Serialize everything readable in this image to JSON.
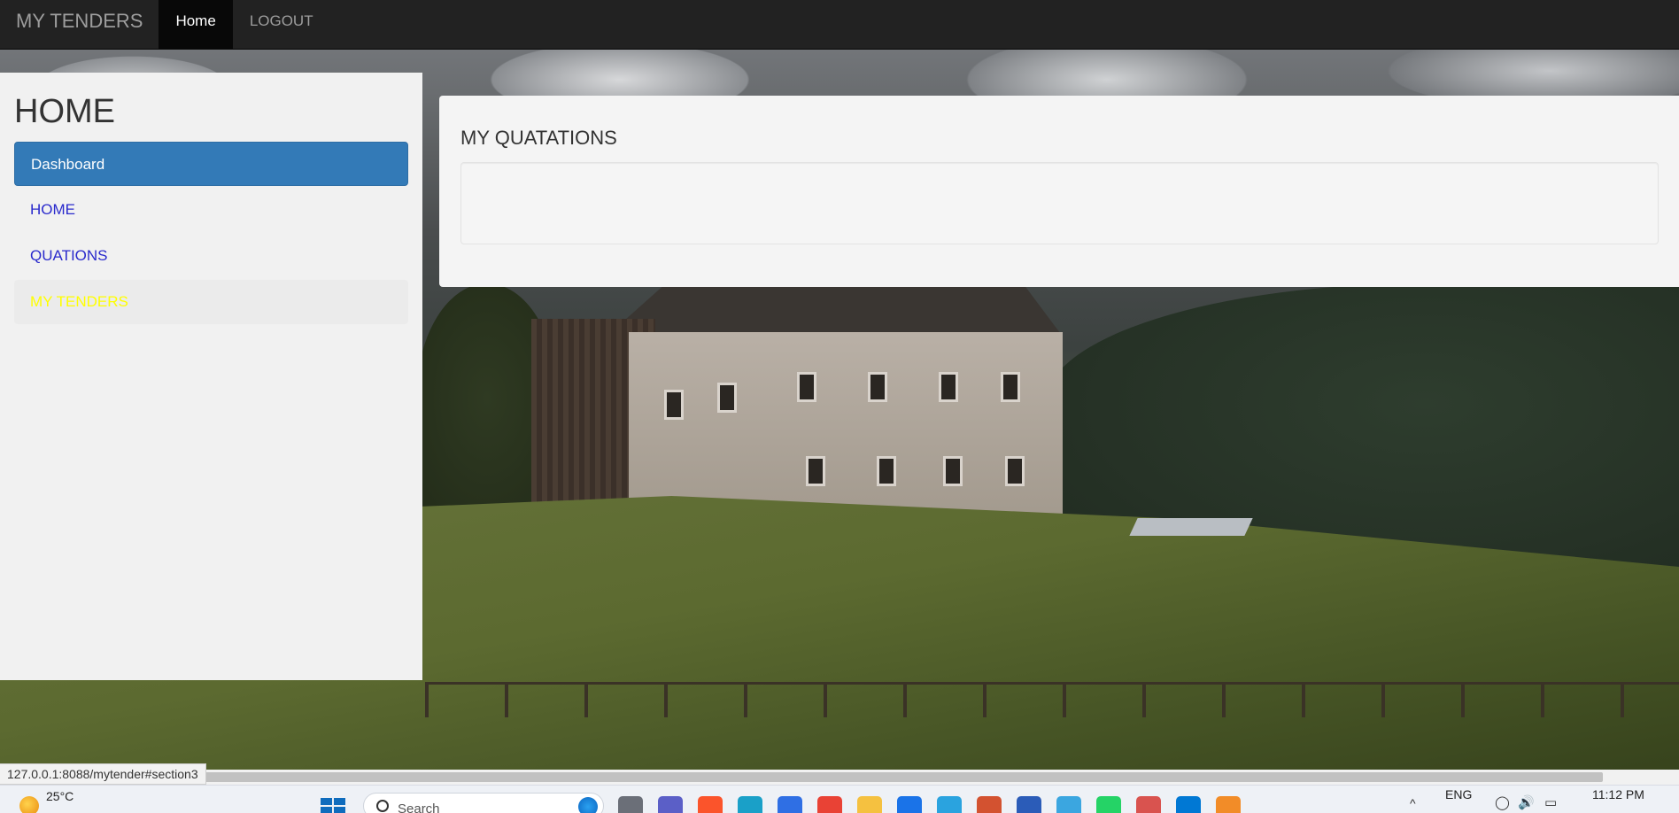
{
  "navbar": {
    "brand": "MY TENDERS",
    "items": [
      {
        "label": "Home",
        "active": true
      },
      {
        "label": "LOGOUT",
        "active": false
      }
    ]
  },
  "sidebar": {
    "title": "HOME",
    "items": [
      {
        "label": "Dashboard",
        "state": "active"
      },
      {
        "label": "HOME",
        "state": "normal"
      },
      {
        "label": "QUATIONS",
        "state": "normal"
      },
      {
        "label": "MY TENDERS",
        "state": "highlight"
      }
    ]
  },
  "main": {
    "panel_title": "MY QUATATIONS"
  },
  "browser": {
    "status_url": "127.0.0.1:8088/mytender#section3"
  },
  "taskbar": {
    "weather_temp": "25°C",
    "search_placeholder": "Search",
    "language": "ENG",
    "time": "11:12 PM",
    "apps": [
      {
        "name": "task-view-icon",
        "color": "#6b6f78"
      },
      {
        "name": "teams-icon",
        "color": "#5b5fc7"
      },
      {
        "name": "brave-icon",
        "color": "#fb542b"
      },
      {
        "name": "edge-icon",
        "color": "#1aa0c8"
      },
      {
        "name": "vscode-insiders-icon",
        "color": "#2f6fe4"
      },
      {
        "name": "chrome-icon",
        "color": "#e94235"
      },
      {
        "name": "file-explorer-icon",
        "color": "#f5c140"
      },
      {
        "name": "store-icon",
        "color": "#1a73e8"
      },
      {
        "name": "telegram-icon",
        "color": "#2aa3df"
      },
      {
        "name": "powerpoint-icon",
        "color": "#d35230"
      },
      {
        "name": "word-icon",
        "color": "#2b5cb8"
      },
      {
        "name": "notepad-icon",
        "color": "#3ba6e0"
      },
      {
        "name": "whatsapp-icon",
        "color": "#25d366"
      },
      {
        "name": "chrome-profile-icon",
        "color": "#d9534f"
      },
      {
        "name": "vscode-icon",
        "color": "#0078d4"
      },
      {
        "name": "app-a-icon",
        "color": "#f28c28"
      }
    ]
  }
}
